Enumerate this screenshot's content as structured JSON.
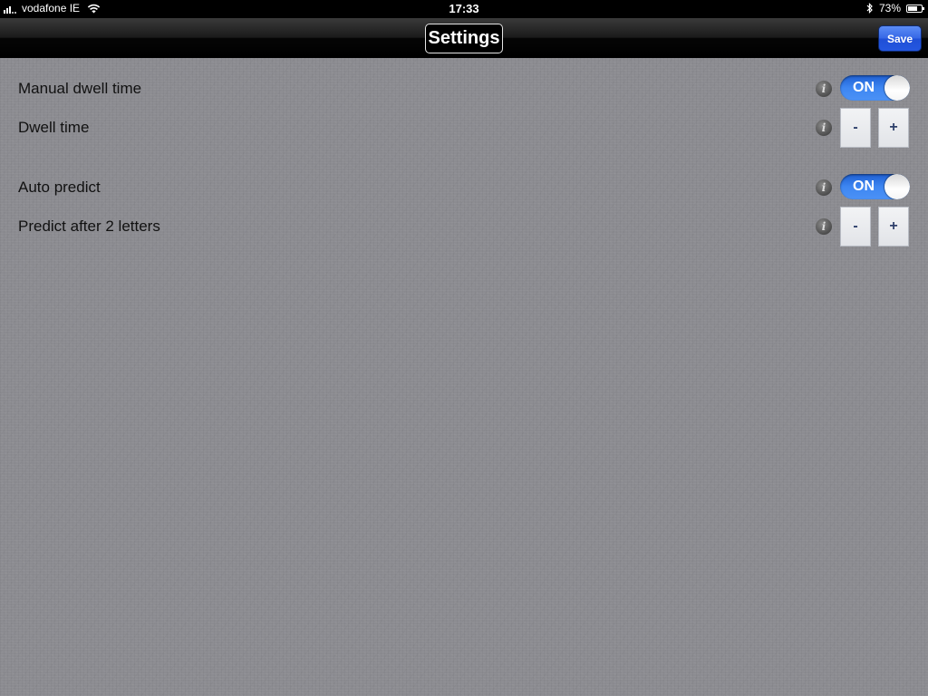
{
  "status_bar": {
    "carrier": "vodafone IE",
    "time": "17:33",
    "battery_percent": "73%",
    "battery_level": 0.73,
    "icons": [
      "signal-bars-icon",
      "wifi-icon",
      "bluetooth-icon",
      "battery-icon"
    ]
  },
  "nav_bar": {
    "title": "Settings",
    "save_label": "Save",
    "save_color": "#3667e6"
  },
  "settings": {
    "manual_dwell": {
      "label": "Manual dwell time",
      "toggle_label": "ON",
      "state": true
    },
    "dwell_time": {
      "label": "Dwell time",
      "minus_label": "-",
      "plus_label": "+"
    },
    "auto_predict": {
      "label": "Auto predict",
      "toggle_label": "ON",
      "state": true
    },
    "predict_after": {
      "label": "Predict after 2 letters",
      "minus_label": "-",
      "plus_label": "+"
    },
    "info_glyph": "i"
  },
  "colors": {
    "toggle_on": "#3d86f2",
    "background": "#8c8c91",
    "nav_bar": "#1a1a1a"
  }
}
